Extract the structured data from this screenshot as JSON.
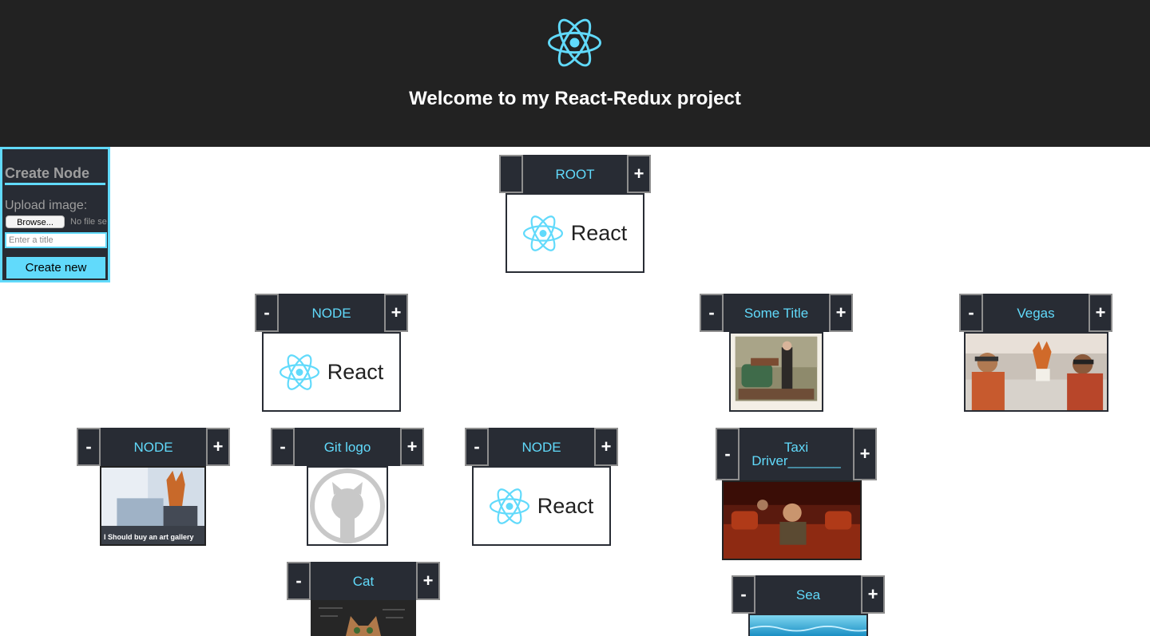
{
  "header": {
    "title": "Welcome to my React-Redux project",
    "logo_icon": "react-atom-icon",
    "background": "#222222",
    "accent": "#61dafb"
  },
  "create_panel": {
    "title": "Create Node",
    "upload_label": "Upload image:",
    "browse_label": "Browse...",
    "no_file_text": "No file se",
    "title_placeholder": "Enter a title",
    "create_button": "Create new"
  },
  "tree": {
    "minus_label": "-",
    "plus_label": "+",
    "react_card_text": "React",
    "nodes": [
      {
        "title": "ROOT",
        "image": "react-logo"
      },
      {
        "title": "NODE",
        "image": "react-logo"
      },
      {
        "title": "Some Title",
        "image": "painting"
      },
      {
        "title": "Vegas",
        "image": "vegas-car-photo"
      },
      {
        "title": "NODE",
        "image": "fox-reading-newspaper-meme",
        "image_caption": "I Should  buy an art gallery"
      },
      {
        "title": "Git logo",
        "image": "github-octocat-logo"
      },
      {
        "title": "NODE",
        "image": "react-logo"
      },
      {
        "title": "Taxi Driver_______",
        "image": "theater-photo"
      },
      {
        "title": "Cat",
        "image": "cat-photo"
      },
      {
        "title": "Sea",
        "image": "sea-photo"
      }
    ]
  }
}
